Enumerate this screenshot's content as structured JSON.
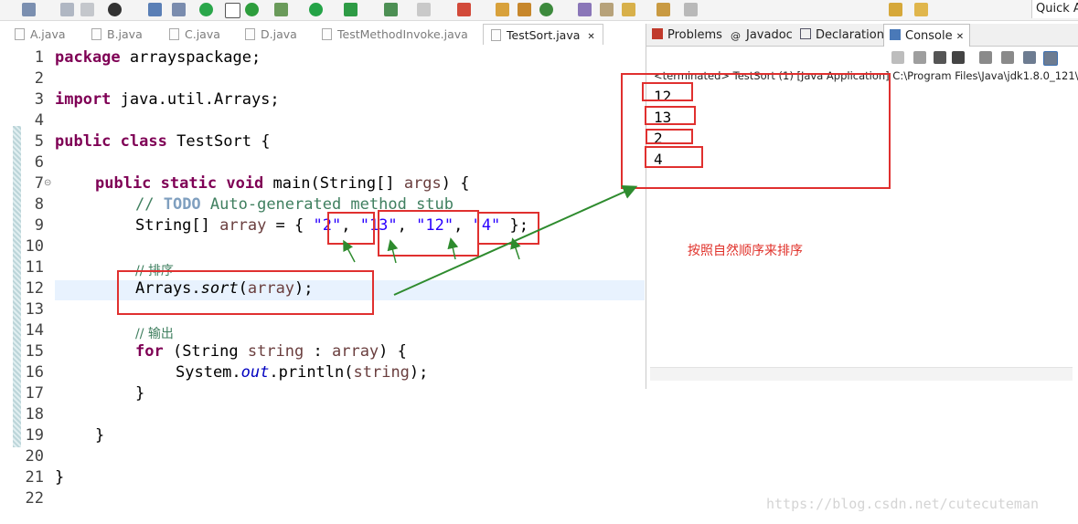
{
  "toolbar": {
    "icons": [
      "new-icon",
      "save-icon",
      "print-icon",
      "user-icon",
      "task-icon",
      "debug-icon",
      "build-icon",
      "run-icon",
      "profile-icon",
      "coverage-icon",
      "stop-icon",
      "external-icon",
      "type-icon",
      "package-icon",
      "refresh-icon",
      "open-folder-icon",
      "pin-icon",
      "search-icon",
      "wand-icon",
      "navigate-icon",
      "edit-icon",
      "annotate-icon",
      "mark-icon",
      "back-icon",
      "forward-icon"
    ],
    "quick_access": "Quick Ac"
  },
  "editor_tabs": [
    "A.java",
    "B.java",
    "C.java",
    "D.java",
    "TestMethodInvoke.java",
    "TestSort.java"
  ],
  "editor_active_tab": "TestSort.java",
  "editor_tab_close": "✕",
  "line_numbers": [
    "1",
    "2",
    "3",
    "4",
    "5",
    "6",
    "7",
    "8",
    "9",
    "10",
    "11",
    "12",
    "13",
    "14",
    "15",
    "16",
    "17",
    "18",
    "19",
    "20",
    "21",
    "22"
  ],
  "code": {
    "l1_kw": "package",
    "l1_rest": " arrayspackage;",
    "l3_kw": "import",
    "l3_rest": " java.util.Arrays;",
    "l5_kw1": "public",
    "l5_kw2": "class",
    "l5_rest": " TestSort {",
    "l7_kw1": "public",
    "l7_kw2": "static",
    "l7_kw3": "void",
    "l7_mid": " main(String[] ",
    "l7_var": "args",
    "l7_end": ") {",
    "l8_cm": "// ",
    "l8_todo": "TODO",
    "l8_rest": " Auto-generated method stub",
    "l9_a": "String[] ",
    "l9_var": "array",
    "l9_b": " = { ",
    "l9_s1": "\"2\"",
    "l9_c1": ", ",
    "l9_s2": "\"13\"",
    "l9_c2": ", ",
    "l9_s3": "\"12\"",
    "l9_c3": ", ",
    "l9_s4": "\"4\"",
    "l9_end": " };",
    "l11_cm": "// 排序",
    "l12_a": "Arrays.",
    "l12_m": "sort",
    "l12_b": "(",
    "l12_var": "array",
    "l12_end": ");",
    "l14_cm": "// 输出",
    "l15_kw": "for",
    "l15_a": " (String ",
    "l15_v1": "string",
    "l15_b": " : ",
    "l15_v2": "array",
    "l15_end": ") {",
    "l16_a": "System.",
    "l16_fld": "out",
    "l16_b": ".println(",
    "l16_var": "string",
    "l16_end": ");",
    "l17": "}",
    "l19": "}",
    "l21": "}"
  },
  "console": {
    "tabs": [
      "Problems",
      "Javadoc",
      "Declaration",
      "Console"
    ],
    "active_tab": "Console",
    "close_glyph": "✕",
    "terminated_text": "<terminated> TestSort (1) [Java Application] C:\\Program Files\\Java\\jdk1.8.0_121\\",
    "output": [
      "12",
      "13",
      "2",
      "4"
    ],
    "tool_icons": [
      "remove-launch-icon",
      "terminate-icon",
      "remove-all-icon",
      "clear-console-icon",
      "scroll-lock-icon",
      "word-wrap-icon",
      "pin-console-icon",
      "display-console-icon"
    ]
  },
  "annotation_note": "按照自然顺序来排序",
  "watermark": "https://blog.csdn.net/cutecuteman",
  "colors": {
    "annotation_red": "#e0302f",
    "arrow_green": "#2e8b2e",
    "keyword": "#7f0055",
    "string": "#2a00ff",
    "comment": "#3f7f5f"
  }
}
